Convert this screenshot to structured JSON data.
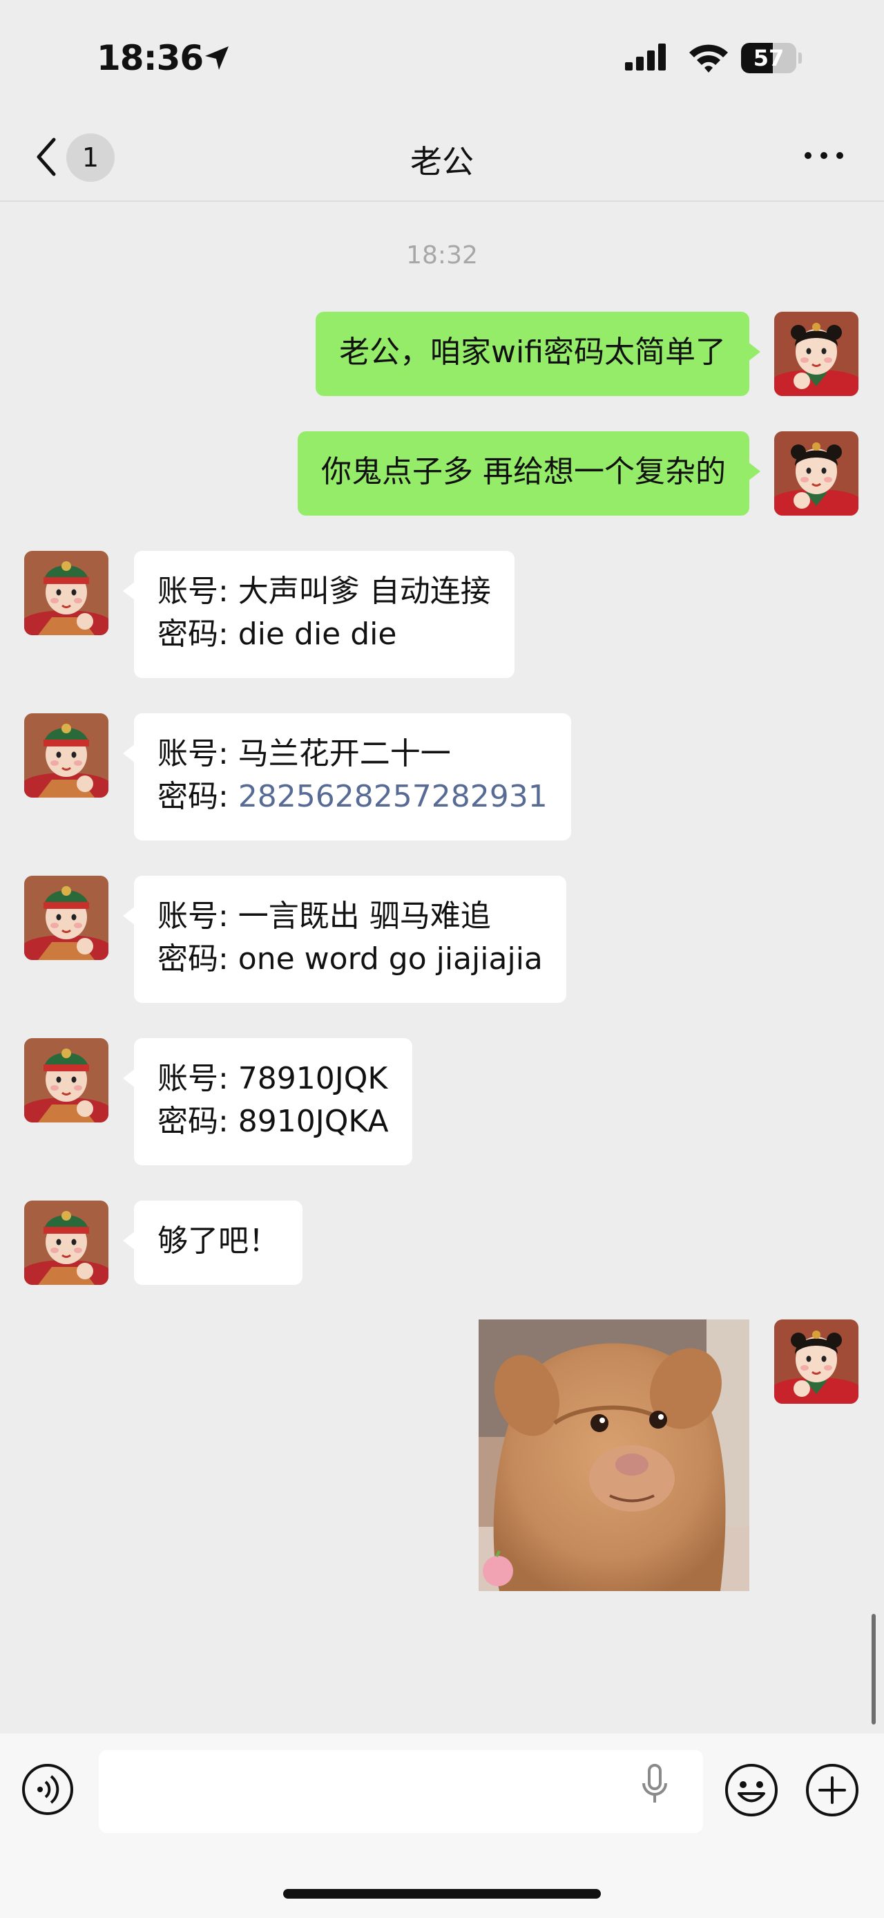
{
  "status_bar": {
    "time": "18:36",
    "battery": "57",
    "battery_level_percent": 57
  },
  "header": {
    "title": "老公",
    "unread_count": "1"
  },
  "chat": {
    "timestamp": "18:32",
    "messages": [
      {
        "from": "me",
        "lines": [
          "老公，咱家wifi密码太简单了"
        ]
      },
      {
        "from": "me",
        "lines": [
          "你鬼点子多 再给想一个复杂的"
        ]
      },
      {
        "from": "husband",
        "lines": [
          "账号: 大声叫爹 自动连接",
          "密码: die die die"
        ]
      },
      {
        "from": "husband",
        "lines": [
          "账号: 马兰花开二十一",
          "密码: "
        ],
        "link_number": "2825628257282931"
      },
      {
        "from": "husband",
        "lines": [
          "账号: 一言既出 驷马难追",
          "密码: one word go jiajiajia"
        ]
      },
      {
        "from": "husband",
        "lines": [
          "账号: 78910JQK",
          "密码: 8910JQKA"
        ]
      },
      {
        "from": "husband",
        "lines": [
          "够了吧！"
        ]
      },
      {
        "from": "me",
        "type": "sticker",
        "sticker": "sad-puppy-sticker"
      }
    ]
  },
  "colors": {
    "outgoing_bubble": "#95ec69",
    "incoming_bubble": "#ffffff",
    "link": "#576b95",
    "background": "#ededed"
  }
}
